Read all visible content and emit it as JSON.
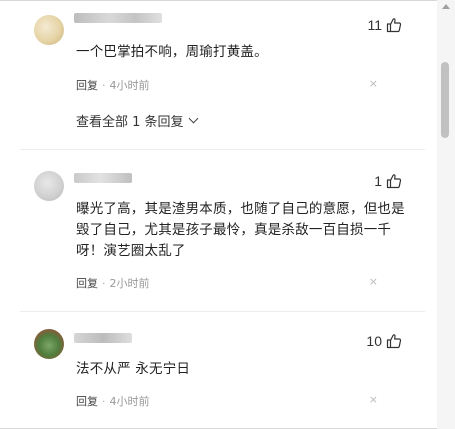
{
  "comments": [
    {
      "likes": "11",
      "text": "一个巴掌拍不响，周瑜打黄盖。",
      "reply_label": "回复",
      "time": "4小时前",
      "dismiss": "×",
      "view_all": "查看全部 1 条回复"
    },
    {
      "likes": "1",
      "text": "曝光了高，其是渣男本质，也随了自己的意愿，但也是毁了自己，尤其是孩子最怜，真是杀敌一百自损一千呀！演艺圈太乱了",
      "reply_label": "回复",
      "time": "2小时前",
      "dismiss": "×"
    },
    {
      "likes": "10",
      "text": "法不从严 永无宁日",
      "reply_label": "回复",
      "time": "4小时前",
      "dismiss": "×"
    }
  ],
  "separator": "·",
  "colors": {
    "accent_like": "#333333",
    "meta_text": "#999999",
    "scroll_thumb": "#c1c1c1"
  },
  "icons": [
    "thumbs-up-icon",
    "chevron-down-icon",
    "close-icon"
  ]
}
